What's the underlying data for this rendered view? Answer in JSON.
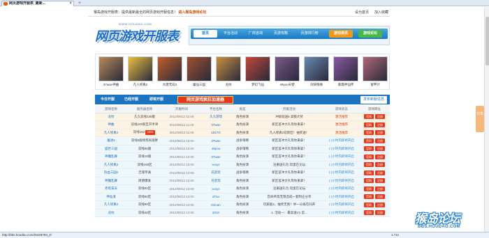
{
  "browser": {
    "tab_title": "网页游戏开服表_最新...",
    "new_tab": "+",
    "status_url": "http://bbs.houdao.com/r6449793_2/",
    "zoom": "1.71s"
  },
  "topbar": {
    "slogan": "猴岛游戏开服表：提供最新最全的网页游戏开服信息！",
    "link": "进入猴岛游戏论坛",
    "set_home": "设为首页",
    "favorite": "加入收藏"
  },
  "logo": {
    "small": "WWW.HOUDAO.COM",
    "big": "网页游戏开服表"
  },
  "nav": {
    "items": [
      "首页",
      "平台活动",
      "厂商咨询",
      "页游攻略",
      "页游排行榜"
    ],
    "btn_news": "游戏资讯",
    "btn_forum": "游戏论坛"
  },
  "games": [
    {
      "name": "37wan神曲",
      "color": "#b88a5a"
    },
    {
      "name": "凡人修真2",
      "color": "#e8c040"
    },
    {
      "name": "大唐无双2",
      "color": "#c0602a"
    },
    {
      "name": "屠仙三国",
      "color": "#a05030"
    },
    {
      "name": "龙纹",
      "color": "#c89040"
    },
    {
      "name": "梦幻飞仙",
      "color": "#c04838"
    },
    {
      "name": "49you天使",
      "color": "#7a5a8a"
    },
    {
      "name": "剑侠情缘",
      "color": "#6a8ab0"
    },
    {
      "name": "紫霞神仙传",
      "color": "#8a5aa0"
    },
    {
      "name": "富甲计",
      "color": "#b06878"
    }
  ],
  "tabs": {
    "today": "今日开服",
    "opened": "已经开服",
    "upcoming": "即将开服",
    "promo": "网页游戏疯狂加速器",
    "publish": "发布新服信息"
  },
  "table": {
    "headers": [
      "游戏名称",
      "服务器名称",
      "开服时间",
      "平台名称",
      "类型",
      "开服活动",
      "游戏状态",
      "游戏网址"
    ],
    "rows": [
      {
        "cls": "hot",
        "game": "龙纹",
        "server": "久久双线138服",
        "time": "2012/08/12 11:00",
        "platform": "久久游戏",
        "type": "角色扮演",
        "event": "冲级就送6 高额大奖",
        "status": "激活推荐",
        "status_cls": "red"
      },
      {
        "cls": "hot",
        "game": "神曲",
        "server": "双线243新区开手男",
        "time": "2012/08/12 11:00",
        "platform": "37wan",
        "type": "角色扮演",
        "event": "新区首冲大礼等你来拿！",
        "status": "激活推荐",
        "status_cls": "red"
      },
      {
        "cls": "hot",
        "game": "凡人修真2",
        "server": "双线162",
        "time": "2012/08/12 11:00",
        "platform": "1817G",
        "type": "角色扮演",
        "event": "凡人修真2双新区！抽奖送！",
        "status": "激活推荐",
        "status_cls": "red",
        "badge": "NEW"
      },
      {
        "cls": "norm",
        "game": "屠进2",
        "server": "双线5服修炼民丽胖",
        "time": "2012/08/12 12:00",
        "platform": "37wan",
        "type": "战争策略",
        "event": "新区首冲大礼等你来拿！",
        "status": "(-)小时内即将开启",
        "status_cls": "blue"
      },
      {
        "cls": "norm",
        "game": "盛世三国",
        "server": "双线85服",
        "time": "2012/08/12 12:00",
        "platform": "49you",
        "type": "战争策略",
        "event": "新区首冲大礼等你来拿！",
        "status": "(-)小时内即将开启",
        "status_cls": "blue"
      },
      {
        "cls": "norm",
        "game": "神魔乱舞",
        "server": "双线18服",
        "time": "2012/08/12 12:00",
        "platform": "37wan",
        "type": "角色扮演",
        "event": "新区首冲大礼等你来拿！",
        "status": "(-)小时内即将开启",
        "status_cls": "blue"
      },
      {
        "cls": "norm",
        "game": "凡人修真2",
        "server": "双线198区",
        "time": "2012/08/12 12:00",
        "platform": "xxxyx",
        "type": "角色扮演",
        "event": "注册送礼包 玩蛋在论坛",
        "status": "(-)小时内即将开启",
        "status_cls": "blue"
      },
      {
        "cls": "norm",
        "game": "热血三国2",
        "server": "吉瑞宇通",
        "time": "2012/08/12 12:00",
        "platform": "兄弟玩",
        "type": "战争策略",
        "event": "新区首冲大礼等你来拿！",
        "status": "(-)小时内即将开启",
        "status_cls": "blue"
      },
      {
        "cls": "norm",
        "game": "神魔乱舞",
        "server": "周德爆发",
        "time": "2012/08/12 12:00",
        "platform": "兄弟玩",
        "type": "角色扮演",
        "event": "新区首冲大礼等你来拿！",
        "status": "(-)小时内即将开启",
        "status_cls": "blue"
      },
      {
        "cls": "norm",
        "game": "赤炼诛天",
        "server": "双线92区",
        "time": "2012/08/12 13:00",
        "platform": "xxxyx",
        "type": "角色扮演",
        "event": "注册送礼包 玩蛋在论坛",
        "status": "(-)小时内即将开启",
        "status_cls": "blue"
      },
      {
        "cls": "norm",
        "game": "神仙道",
        "server": "双线90区",
        "time": "2012/08/12 13:00",
        "platform": "aTuu",
        "type": "角色扮演",
        "event": "宫命终焉无限造成一套附庄分享",
        "status": "(-)小时内即将开启",
        "status_cls": "blue"
      },
      {
        "cls": "norm",
        "game": "凡人修真2",
        "server": "双线98区",
        "time": "2012/08/12 13:00",
        "platform": "91loan",
        "type": "角色扮演",
        "event": "玩家能2，抽奖无限！举一分再在同开",
        "status": "(-)小时内即将开启",
        "status_cls": "blue"
      },
      {
        "cls": "norm",
        "game": "龙纹",
        "server": "双线48区",
        "time": "2012/08/12 13:00",
        "platform": "2010",
        "type": "角色扮演",
        "event": "1. 活动一：最高送V1 首...",
        "status": "(-)小时内即将开启",
        "status_cls": "blue"
      }
    ],
    "btn_home": "官网",
    "btn_reg": "注册"
  },
  "side": {
    "label": "分享"
  },
  "watermark": {
    "big": "猴岛论坛",
    "small": "BBS.HOUDAO.COM"
  }
}
